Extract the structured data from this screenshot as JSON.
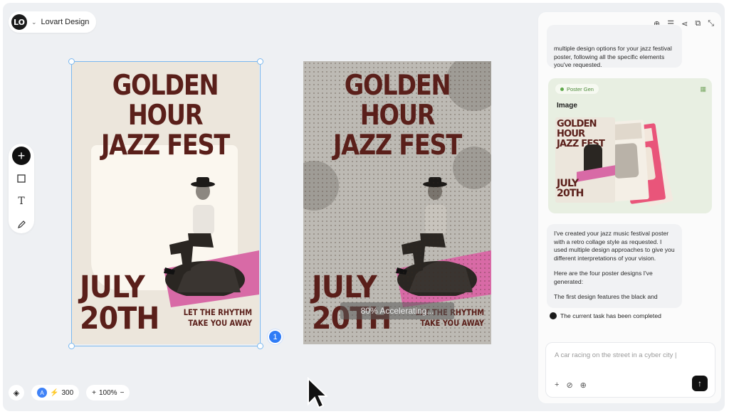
{
  "brand": {
    "logo_text": "LO",
    "name": "Lovart Design"
  },
  "toolbar": {
    "icons": [
      "add-icon",
      "rectangle-icon",
      "text-icon",
      "pen-icon"
    ]
  },
  "posters": [
    {
      "title_line1": "GOLDEN HOUR",
      "title_line2": "JAZZ FEST",
      "date_line1": "JULY",
      "date_line2": "20TH",
      "tagline_line1": "LET THE RHYTHM",
      "tagline_line2": "TAKE YOU AWAY"
    },
    {
      "title_line1": "GOLDEN HOUR",
      "title_line2": "JAZZ FEST",
      "date_line1": "JULY",
      "date_line2": "20TH",
      "tagline_line1": "LET THE RHYTHM",
      "tagline_line2": "TAKE YOU AWAY",
      "progress_text": "80% Accelerating..."
    }
  ],
  "selection": {
    "page_number": "1"
  },
  "bottom": {
    "avatar": "A",
    "credits": "300",
    "zoom": "100%",
    "zoom_in": "+",
    "zoom_out": "−"
  },
  "panel": {
    "header_icons": [
      "new-chat-icon",
      "history-icon",
      "share-icon",
      "expand-icon",
      "collapse-icon"
    ],
    "message1": "multiple design options for your jazz festival poster, following all the specific elements you've requested.",
    "card_tag": "Poster Gen",
    "card_title": "Image",
    "message2_p1": "I've created your jazz music festival poster with a retro collage style as requested. I used multiple design approaches to give you different interpretations of your vision.",
    "message2_p2": "Here are the four poster designs I've generated:",
    "message2_p3": "The first design features the black and",
    "status": "The current task has been completed",
    "input_placeholder": "A car racing on the street in a cyber city |",
    "input_icons": [
      "plus-icon",
      "attach-icon",
      "globe-icon"
    ]
  },
  "colors": {
    "poster_text": "#5a1f1a",
    "pink": "#d86aa6",
    "selection": "#7bb8ef",
    "badge": "#2f7cf6"
  }
}
